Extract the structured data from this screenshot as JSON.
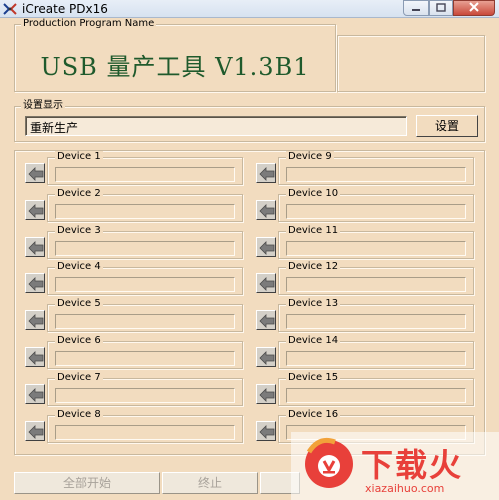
{
  "window": {
    "title": "iCreate PDx16",
    "min_icon": "minimize-icon",
    "max_icon": "maximize-icon",
    "close_icon": "close-icon"
  },
  "program": {
    "group_label": "Production Program Name",
    "name": "USB 量产工具 V1.3B1"
  },
  "settings": {
    "group_label": "设置显示",
    "display_value": "重新生产",
    "button_label": "设置"
  },
  "devices": [
    {
      "label": "Device 1"
    },
    {
      "label": "Device 2"
    },
    {
      "label": "Device 3"
    },
    {
      "label": "Device 4"
    },
    {
      "label": "Device 5"
    },
    {
      "label": "Device 6"
    },
    {
      "label": "Device 7"
    },
    {
      "label": "Device 8"
    },
    {
      "label": "Device 9"
    },
    {
      "label": "Device 10"
    },
    {
      "label": "Device 11"
    },
    {
      "label": "Device 12"
    },
    {
      "label": "Device 13"
    },
    {
      "label": "Device 14"
    },
    {
      "label": "Device 15"
    },
    {
      "label": "Device 16"
    }
  ],
  "bottom": {
    "start_all": "全部开始",
    "stop": "终止"
  },
  "watermark": {
    "text": "下载火",
    "url": "xiazaihuo.com"
  },
  "colors": {
    "background": "#f2dcbf",
    "program_name": "#1f5a2c",
    "watermark_red": "#e8403a"
  }
}
